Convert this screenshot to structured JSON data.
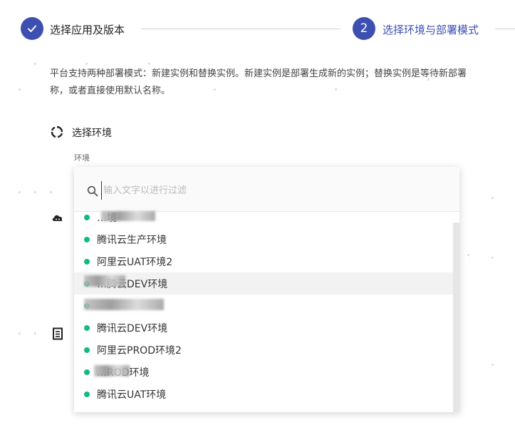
{
  "steps": [
    {
      "number": "✓",
      "label": "选择应用及版本",
      "state": "done"
    },
    {
      "number": "2",
      "label": "选择环境与部署模式",
      "state": "active"
    }
  ],
  "description": {
    "line1": "平台支持两种部署模式：新建实例和替换实例。新建实例是部署生成新的实例；替换实例是等待新部署",
    "line2": "称，或者直接使用默认名称。"
  },
  "section": {
    "title": "选择环境",
    "field_label": "环境"
  },
  "dropdown": {
    "placeholder": "输入文字以进行过滤",
    "options": [
      {
        "label": "…境"
      },
      {
        "label": "腾讯云生产环境"
      },
      {
        "label": "阿里云UAT环境2"
      },
      {
        "label": "…腾云DEV环境"
      },
      {
        "label": ""
      },
      {
        "label": "腾讯云DEV环境"
      },
      {
        "label": "阿里云PROD环境2"
      },
      {
        "label": "…ROD环境"
      },
      {
        "label": "腾讯云UAT环境"
      }
    ],
    "status_color": "#12b886"
  },
  "colors": {
    "accent": "#3d4fb0"
  }
}
